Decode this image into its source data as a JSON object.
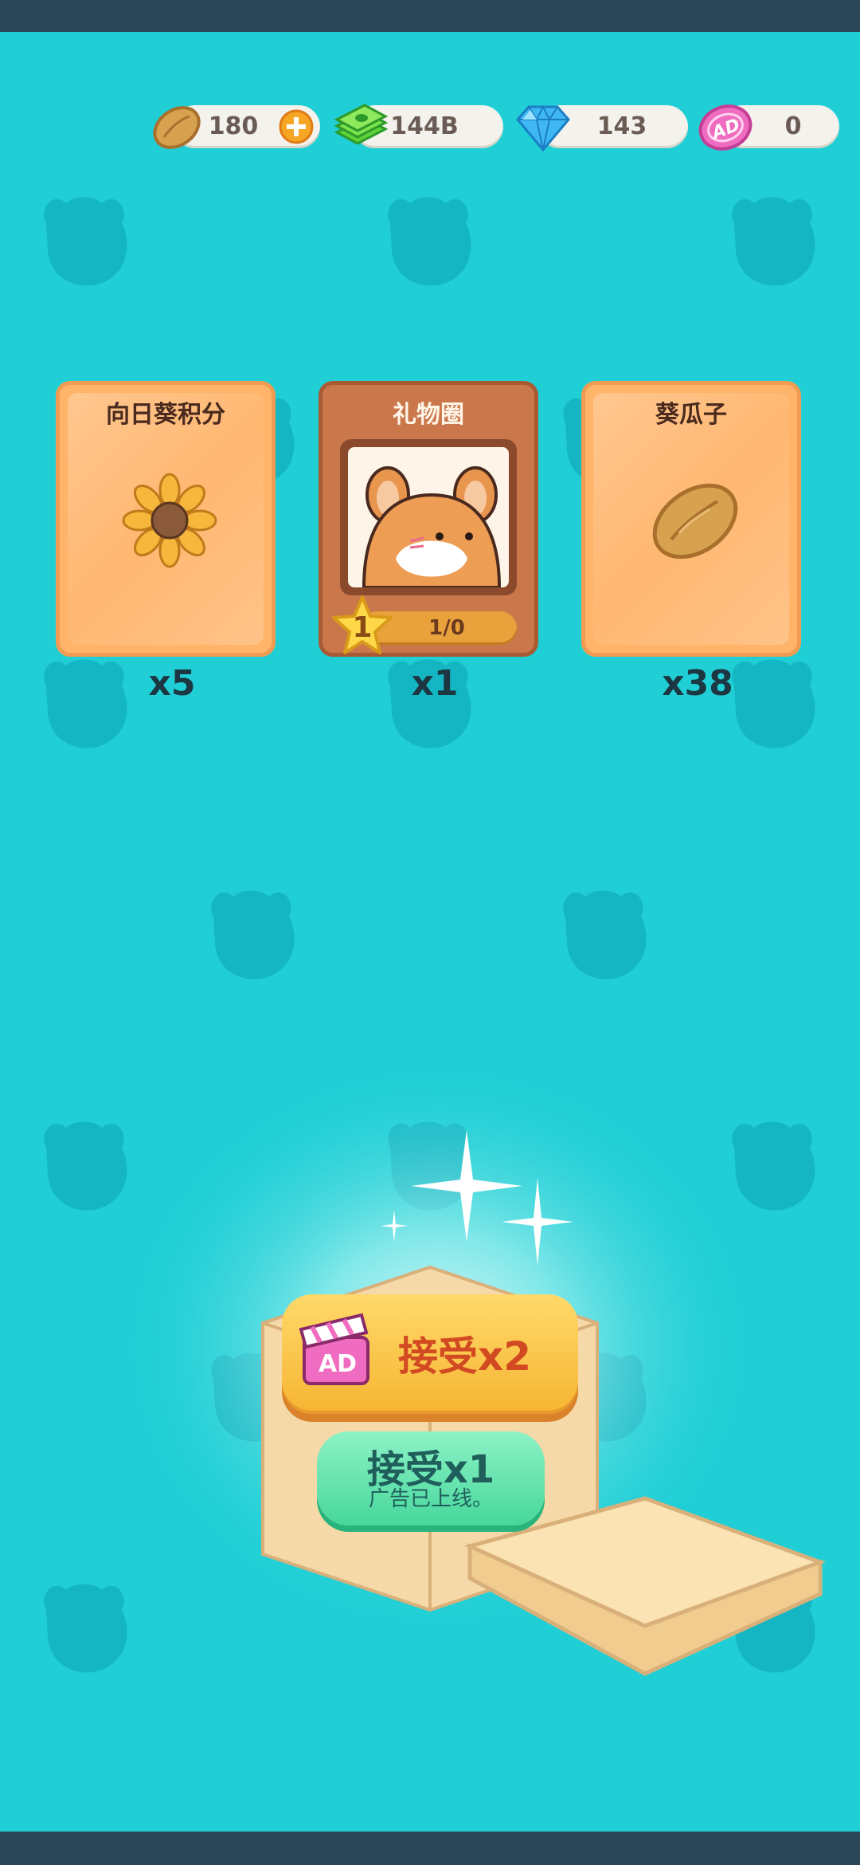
{
  "currencies": [
    {
      "name": "seeds",
      "value": "180",
      "icon": "seed-icon",
      "has_add": true
    },
    {
      "name": "cash",
      "value": "144B",
      "icon": "cash-icon"
    },
    {
      "name": "diamonds",
      "value": "143",
      "icon": "diamond-icon"
    },
    {
      "name": "ad-tickets",
      "value": "0",
      "icon": "ad-ticket-icon"
    }
  ],
  "rewards": [
    {
      "title": "向日葵积分",
      "count": "x5",
      "icon": "sunflower-icon"
    },
    {
      "title": "礼物圈",
      "count": "x1",
      "icon": "hamster-icon",
      "level": "1",
      "progress": "1/0"
    },
    {
      "title": "葵瓜子",
      "count": "x38",
      "icon": "seed-icon"
    }
  ],
  "buttons": {
    "accept_x2": "接受x2",
    "ad_badge": "AD",
    "accept_x1": "接受x1",
    "accept_x1_sub": "广告已上线。"
  },
  "colors": {
    "background": "#20CFD6",
    "top_bar": "#2B4757",
    "card_orange": "#FFB46A",
    "card_brown": "#C9774B",
    "button_yellow": "#F6B532",
    "button_green": "#47D79B"
  }
}
